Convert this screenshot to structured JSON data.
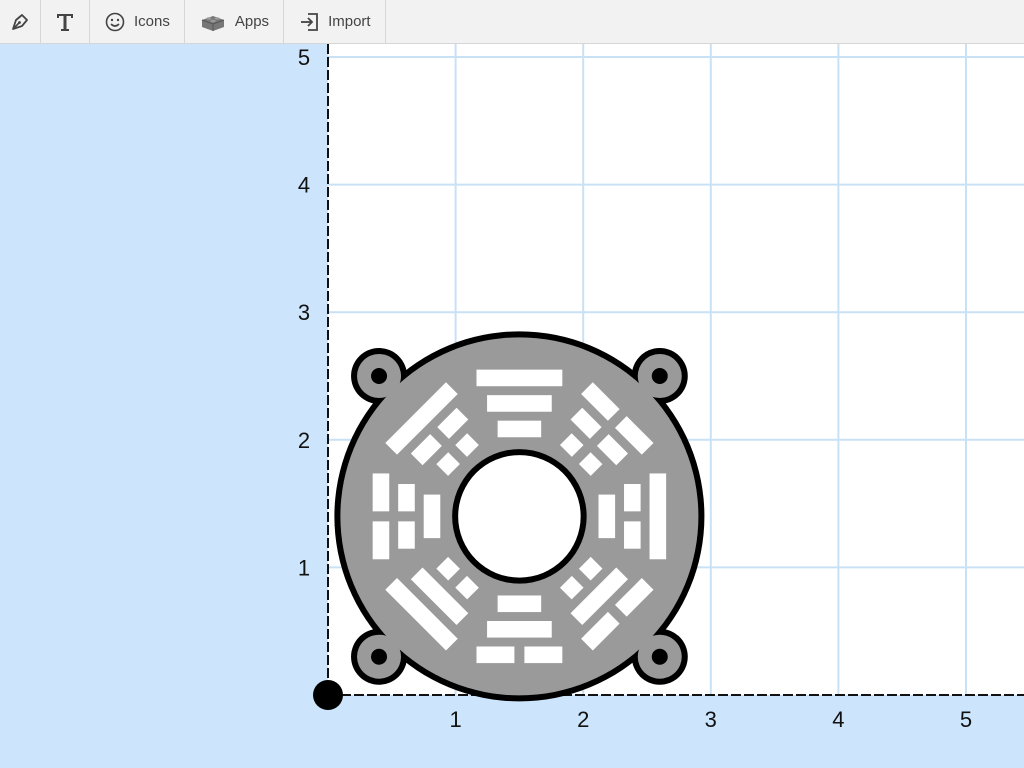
{
  "toolbar": {
    "pen_tool_icon": "pen-nib-icon",
    "text_tool_icon": "text-T-icon",
    "icons_label": "Icons",
    "apps_label": "Apps",
    "import_label": "Import"
  },
  "canvas": {
    "x_ticks": [
      "1",
      "2",
      "3",
      "4",
      "5"
    ],
    "y_ticks": [
      "1",
      "2",
      "3",
      "4",
      "5"
    ],
    "colors": {
      "background": "#cce5fc",
      "plate": "#ffffff",
      "grid": "#c9e1f5",
      "shape_fill": "#9a9a9a",
      "shape_stroke": "#000000"
    }
  },
  "shape": {
    "name": "bagua-trigram-fan-grill",
    "center": [
      1.5,
      1.4
    ],
    "outer_radius": 1.45,
    "inner_radius": 0.48
  }
}
